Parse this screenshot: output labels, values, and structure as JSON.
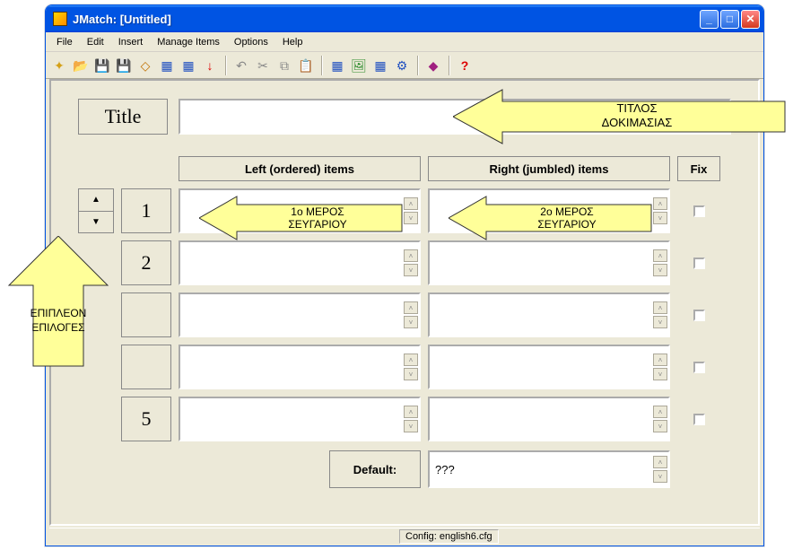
{
  "window": {
    "title": "JMatch: [Untitled]"
  },
  "menubar": [
    "File",
    "Edit",
    "Insert",
    "Manage Items",
    "Options",
    "Help"
  ],
  "toolbar_icons": [
    "new",
    "open",
    "save",
    "saveall",
    "del",
    "grid1",
    "grid2",
    "down",
    "sep",
    "undo",
    "cut",
    "copy",
    "paste",
    "sep",
    "web1",
    "img",
    "web3",
    "web4",
    "sep",
    "cfg",
    "sep",
    "help"
  ],
  "title_section": {
    "label": "Title",
    "value": ""
  },
  "columns": {
    "left_header": "Left (ordered) items",
    "right_header": "Right (jumbled) items",
    "fix_header": "Fix"
  },
  "rows": [
    {
      "num": "1",
      "left": "",
      "right": "",
      "fix": false
    },
    {
      "num": "2",
      "left": "",
      "right": "",
      "fix": false
    },
    {
      "num": "",
      "left": "",
      "right": "",
      "fix": false
    },
    {
      "num": "",
      "left": "",
      "right": "",
      "fix": false
    },
    {
      "num": "5",
      "left": "",
      "right": "",
      "fix": false
    }
  ],
  "default_section": {
    "label": "Default:",
    "value": "???"
  },
  "statusbar": {
    "config": "Config: english6.cfg"
  },
  "callouts": {
    "title_callout": "ΤΙΤΛΟΣ\nΔΟΚΙΜΑΣΙΑΣ",
    "left_item_callout": "1ο ΜΕΡΟΣ\nΣΕΥΓΑΡΙΟΥ",
    "right_item_callout": "2ο ΜΕΡΟΣ\nΣΕΥΓΑΡΙΟΥ",
    "extra_callout": "ΕΠΙΠΛΕΟΝ\nΕΠΙΛΟΓΕΣ"
  }
}
